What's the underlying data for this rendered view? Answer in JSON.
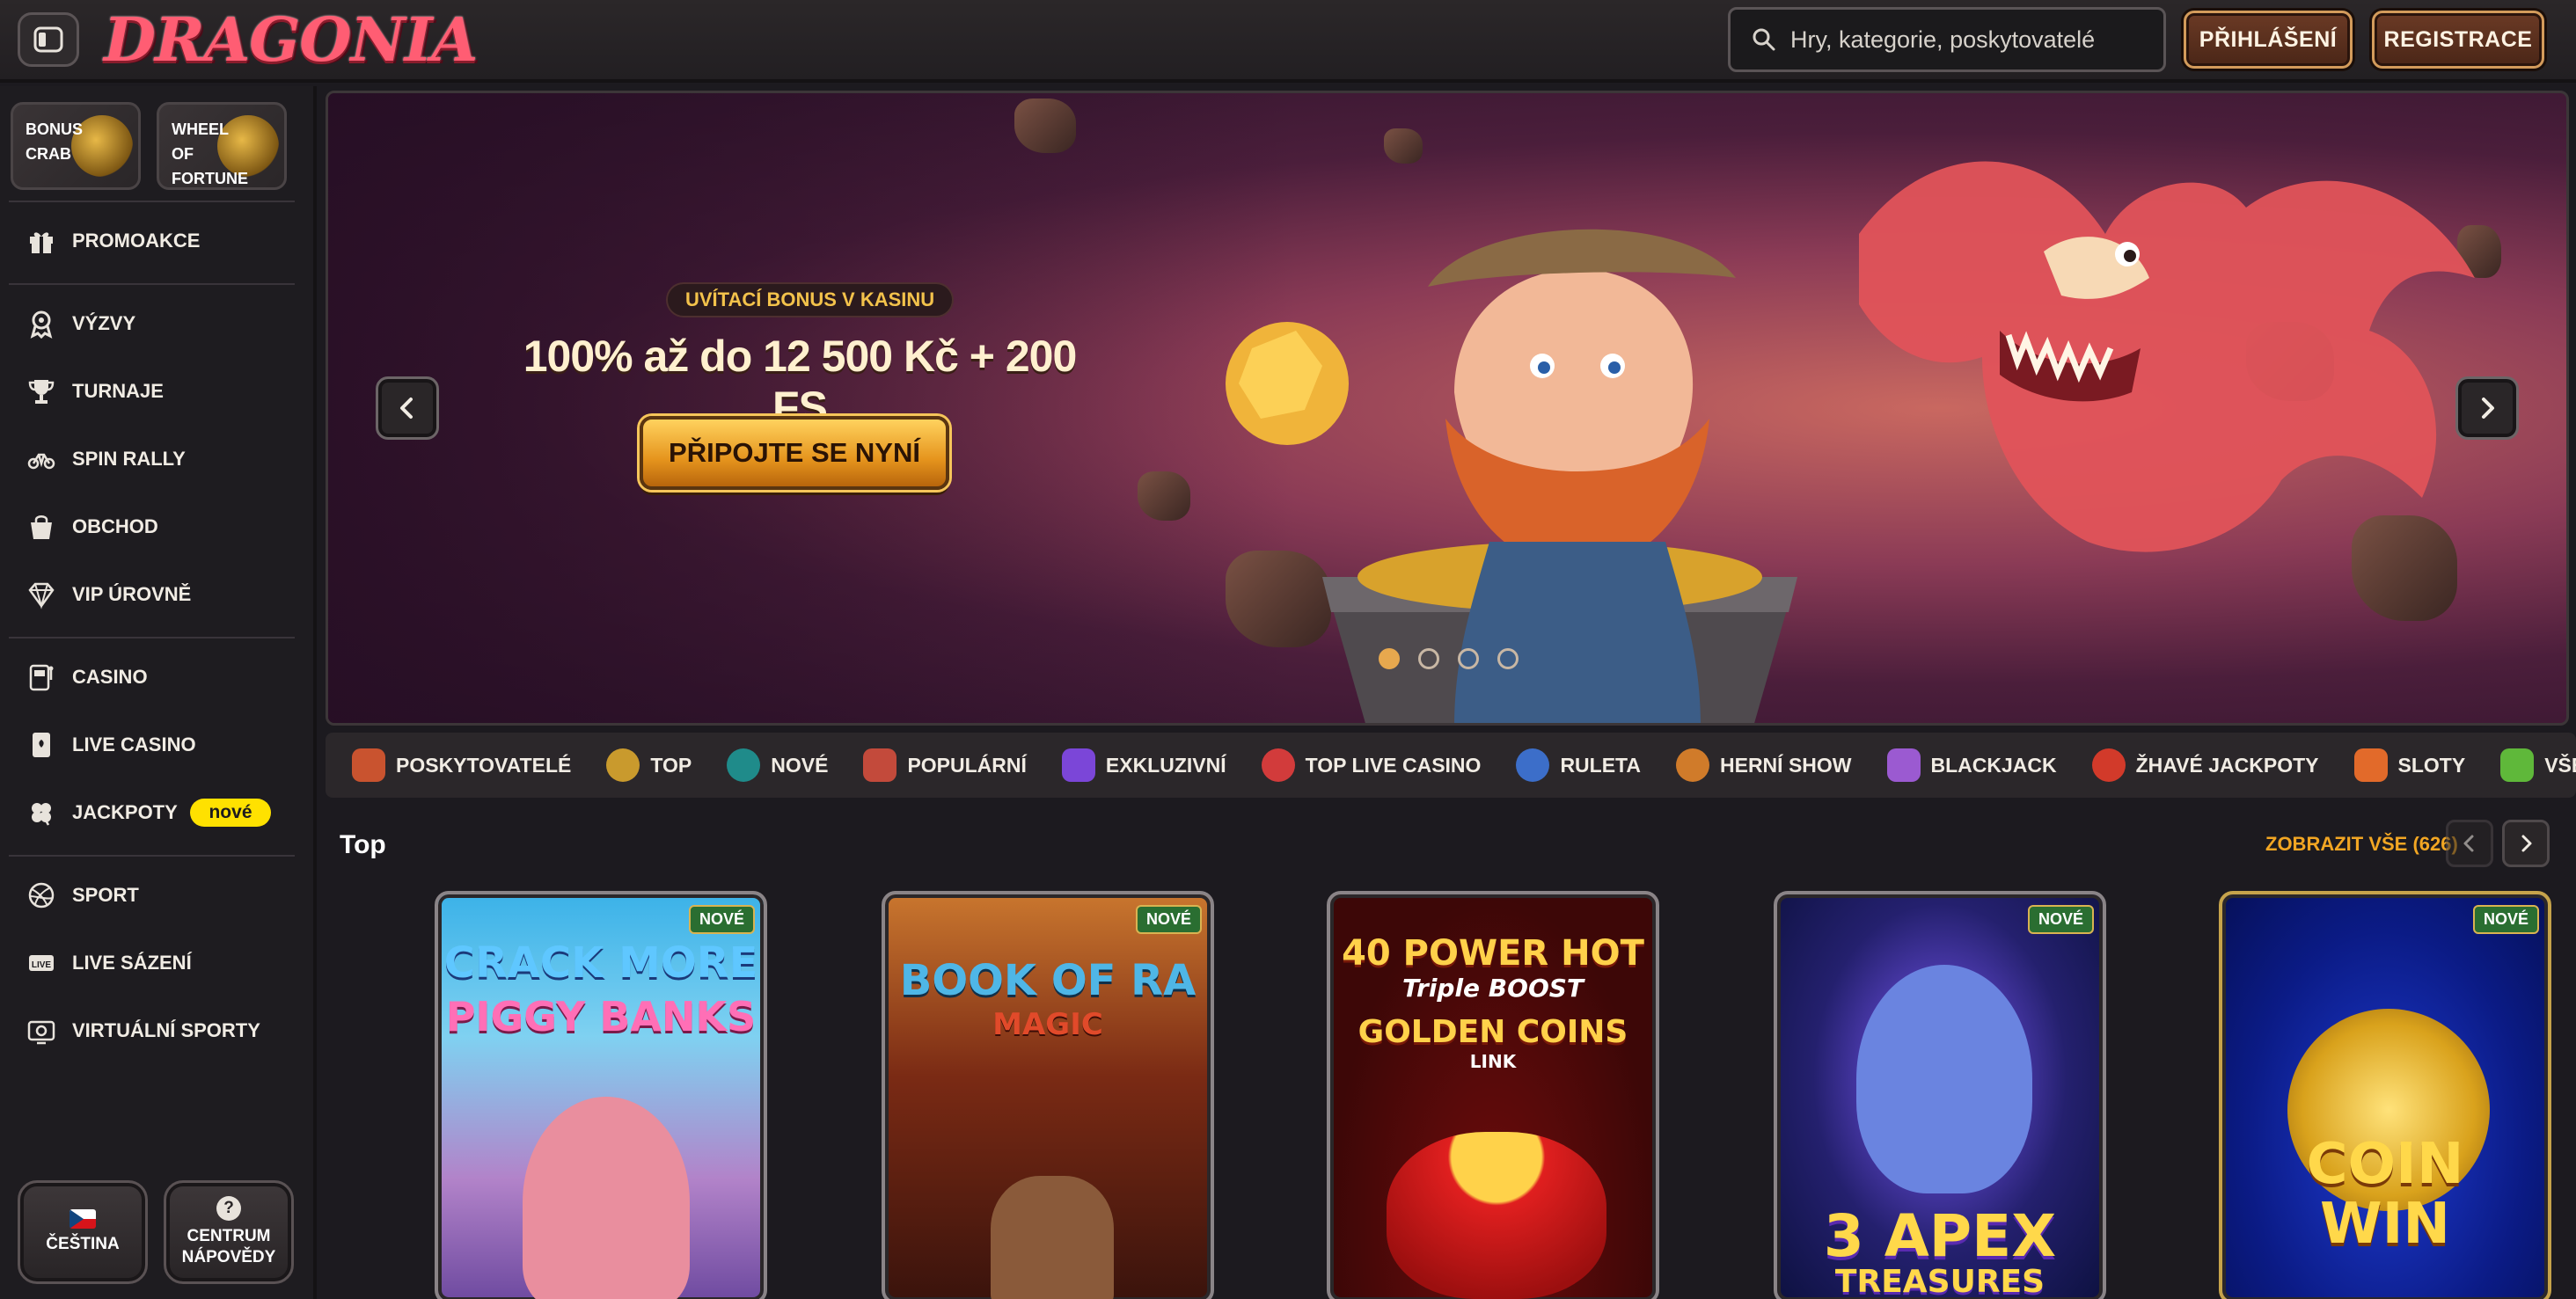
{
  "header": {
    "logo_text": "DRAGONIA",
    "search_placeholder": "Hry, kategorie, poskytovatelé",
    "login_label": "PŘIHLÁŠENÍ",
    "register_label": "REGISTRACE"
  },
  "sidebar": {
    "promo_tiles": [
      {
        "label": "BONUS CRAB"
      },
      {
        "label": "WHEEL OF FORTUNE"
      }
    ],
    "items": [
      {
        "label": "PROMOAKCE",
        "icon": "gift-icon"
      },
      {
        "label": "VÝZVY",
        "icon": "challenge-icon"
      },
      {
        "label": "TURNAJE",
        "icon": "trophy-icon"
      },
      {
        "label": "SPIN RALLY",
        "icon": "rally-icon"
      },
      {
        "label": "OBCHOD",
        "icon": "shop-bag-icon"
      },
      {
        "label": "VIP ÚROVNĚ",
        "icon": "diamond-icon"
      },
      {
        "label": "CASINO",
        "icon": "slot-machine-icon"
      },
      {
        "label": "LIVE CASINO",
        "icon": "card-icon"
      },
      {
        "label": "JACKPOTY",
        "icon": "clover-icon",
        "badge": "nové"
      },
      {
        "label": "SPORT",
        "icon": "ball-icon"
      },
      {
        "label": "LIVE SÁZENÍ",
        "icon": "live-icon"
      },
      {
        "label": "VIRTUÁLNÍ SPORTY",
        "icon": "virtual-icon"
      }
    ],
    "language_label": "ČEŠTINA",
    "help_label_1": "CENTRUM",
    "help_label_2": "NÁPOVĚDY"
  },
  "banner": {
    "tag": "UVÍTACÍ BONUS V KASINU",
    "title": "100% až do 12 500 Kč + 200 FS",
    "cta": "PŘIPOJTE SE NYNÍ",
    "slides": 4,
    "active_slide": 1
  },
  "categories": [
    {
      "label": "POSKYTOVATELÉ",
      "color": "#c9532f"
    },
    {
      "label": "TOP",
      "color": "#c99a2d"
    },
    {
      "label": "NOVÉ",
      "color": "#1f8b8a"
    },
    {
      "label": "POPULÁRNÍ",
      "color": "#c34a3b"
    },
    {
      "label": "EXKLUZIVNÍ",
      "color": "#7b46d8"
    },
    {
      "label": "TOP LIVE CASINO",
      "color": "#d23b3b"
    },
    {
      "label": "RULETA",
      "color": "#3c6ec9"
    },
    {
      "label": "HERNÍ SHOW",
      "color": "#d07b2a"
    },
    {
      "label": "BLACKJACK",
      "color": "#9b5ad1"
    },
    {
      "label": "ŽHAVÉ JACKPOTY",
      "color": "#d23a2a"
    },
    {
      "label": "SLOTY",
      "color": "#e26a2a"
    },
    {
      "label": "VŠECH",
      "color": "#5fb83a"
    }
  ],
  "top_section": {
    "title": "Top",
    "view_all": "ZOBRAZIT VŠE (626)",
    "new_tag": "NOVÉ",
    "games": [
      {
        "line1": "CRACK MORE",
        "line2": "PIGGY BANKS",
        "new": true
      },
      {
        "line1": "BOOK OF RA",
        "line2": "MAGIC",
        "new": true
      },
      {
        "line1": "40 POWER HOT",
        "line2": "Triple BOOST",
        "line3": "GOLDEN COINS",
        "line4": "LINK",
        "new": false
      },
      {
        "line1": "3 APEX",
        "line2": "TREASURES",
        "new": true
      },
      {
        "line1": "COIN",
        "line2": "WIN",
        "new": true
      }
    ]
  }
}
